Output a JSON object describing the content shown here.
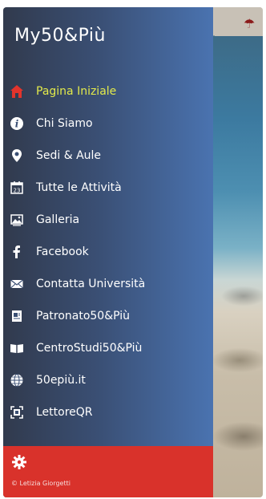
{
  "app": {
    "title": "My50&Più"
  },
  "menu": {
    "items": [
      {
        "label": "Pagina Iniziale",
        "icon": "home-icon",
        "active": true
      },
      {
        "label": "Chi Siamo",
        "icon": "info-icon"
      },
      {
        "label": "Sedi & Aule",
        "icon": "location-pin-icon"
      },
      {
        "label": "Tutte le Attività",
        "icon": "calendar-icon"
      },
      {
        "label": "Galleria",
        "icon": "gallery-icon"
      },
      {
        "label": "Facebook",
        "icon": "facebook-icon"
      },
      {
        "label": "Contatta Università",
        "icon": "mail-icon"
      },
      {
        "label": "Patronato50&Più",
        "icon": "patronato-icon"
      },
      {
        "label": "CentroStudi50&Più",
        "icon": "book-icon"
      },
      {
        "label": "50epiù.it",
        "icon": "globe-icon"
      },
      {
        "label": "LettoreQR",
        "icon": "qr-scanner-icon"
      }
    ]
  },
  "footer": {
    "copyright": "© Letizia Giorgetti",
    "icon": "settings-gear-icon"
  },
  "colors": {
    "drawer_dark": "#313a4d",
    "drawer_light": "#4a73b0",
    "active_text": "#e3ea4a",
    "home_icon": "#e2342c",
    "footer": "#d9322b"
  }
}
